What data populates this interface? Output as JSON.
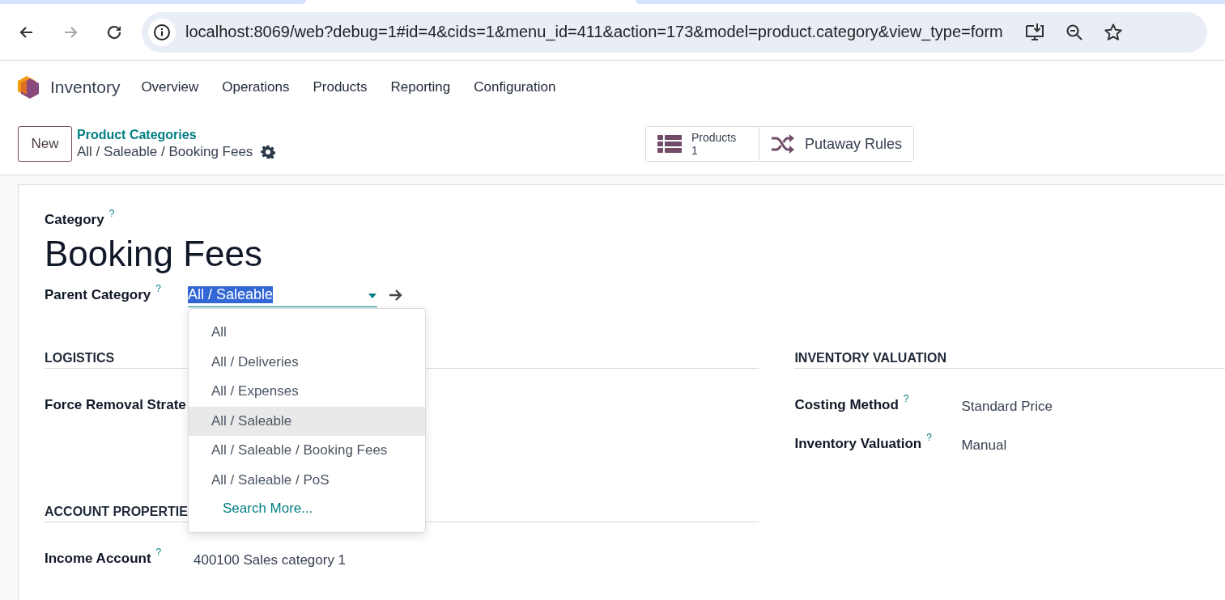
{
  "browser": {
    "nav_buttons": [
      {
        "kind": "back",
        "disabled": false
      },
      {
        "kind": "forward",
        "disabled": true
      },
      {
        "kind": "reload",
        "disabled": false
      }
    ],
    "url": "localhost:8069/web?debug=1#id=4&cids=1&menu_id=411&action=173&model=product.category&view_type=form"
  },
  "app": {
    "name": "Inventory",
    "menu": [
      "Overview",
      "Operations",
      "Products",
      "Reporting",
      "Configuration"
    ]
  },
  "control_panel": {
    "new_button": "New",
    "breadcrumb": "Product Categories",
    "record_path": "All / Saleable / Booking Fees",
    "smart_buttons": [
      {
        "kind": "stat",
        "label": "Products",
        "value": "1"
      },
      {
        "kind": "plain",
        "label": "Putaway Rules"
      }
    ]
  },
  "form": {
    "name_label": "Category",
    "name_help": "?",
    "name": "Booking Fees",
    "parent": {
      "label": "Parent Category",
      "help": "?",
      "value": "All / Saleable"
    },
    "left_sections": [
      {
        "title": "LOGISTICS",
        "fields": [
          {
            "label": "Force Removal Strate"
          }
        ]
      },
      {
        "title": "ACCOUNT PROPERTIE",
        "fields": [
          {
            "label": "Income Account",
            "help": "?",
            "value": "400100 Sales category 1"
          }
        ]
      }
    ],
    "right_sections": [
      {
        "title": "INVENTORY VALUATION",
        "fields": [
          {
            "label": "Costing Method",
            "help": "?",
            "value": "Standard Price"
          },
          {
            "label": "Inventory Valuation",
            "help": "?",
            "value": "Manual"
          }
        ]
      }
    ]
  },
  "dropdown": {
    "options": [
      {
        "label": "All",
        "selected": false
      },
      {
        "label": "All / Deliveries",
        "selected": false
      },
      {
        "label": "All / Expenses",
        "selected": false
      },
      {
        "label": "All / Saleable",
        "selected": true
      },
      {
        "label": "All / Saleable / Booking Fees",
        "selected": false
      },
      {
        "label": "All / Saleable / PoS",
        "selected": false
      }
    ],
    "search_more": "Search More..."
  }
}
